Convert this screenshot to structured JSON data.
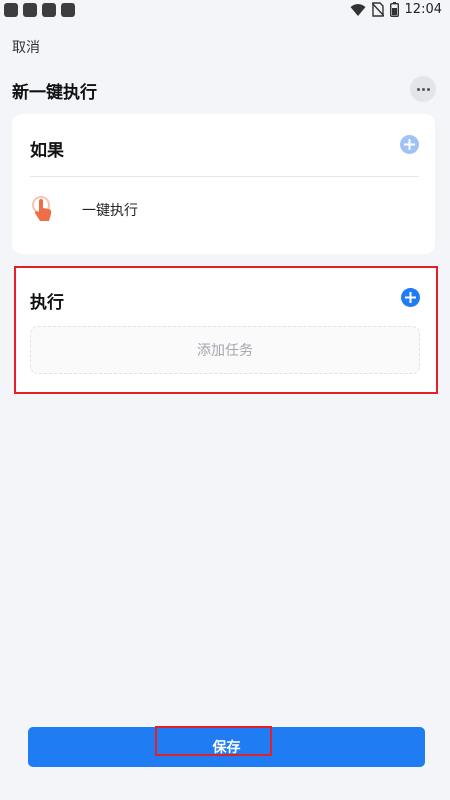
{
  "status_bar": {
    "time": "12:04",
    "icons": [
      "wifi-icon",
      "no-sim-icon",
      "battery-icon"
    ]
  },
  "header": {
    "cancel_label": "取消",
    "title": "新一键执行",
    "more_icon": "more-icon"
  },
  "if_section": {
    "title": "如果",
    "add_icon": "add-circle-icon",
    "trigger": {
      "icon": "tap-hand-icon",
      "label": "一键执行"
    }
  },
  "do_section": {
    "title": "执行",
    "add_icon": "add-circle-icon",
    "add_task_label": "添加任务"
  },
  "footer": {
    "save_label": "保存"
  },
  "colors": {
    "accent": "#1f7cf2",
    "accent_light": "#9fc3f7",
    "highlight": "#e32027",
    "trigger_icon": "#ee6e46",
    "background": "#f4f5f9"
  }
}
